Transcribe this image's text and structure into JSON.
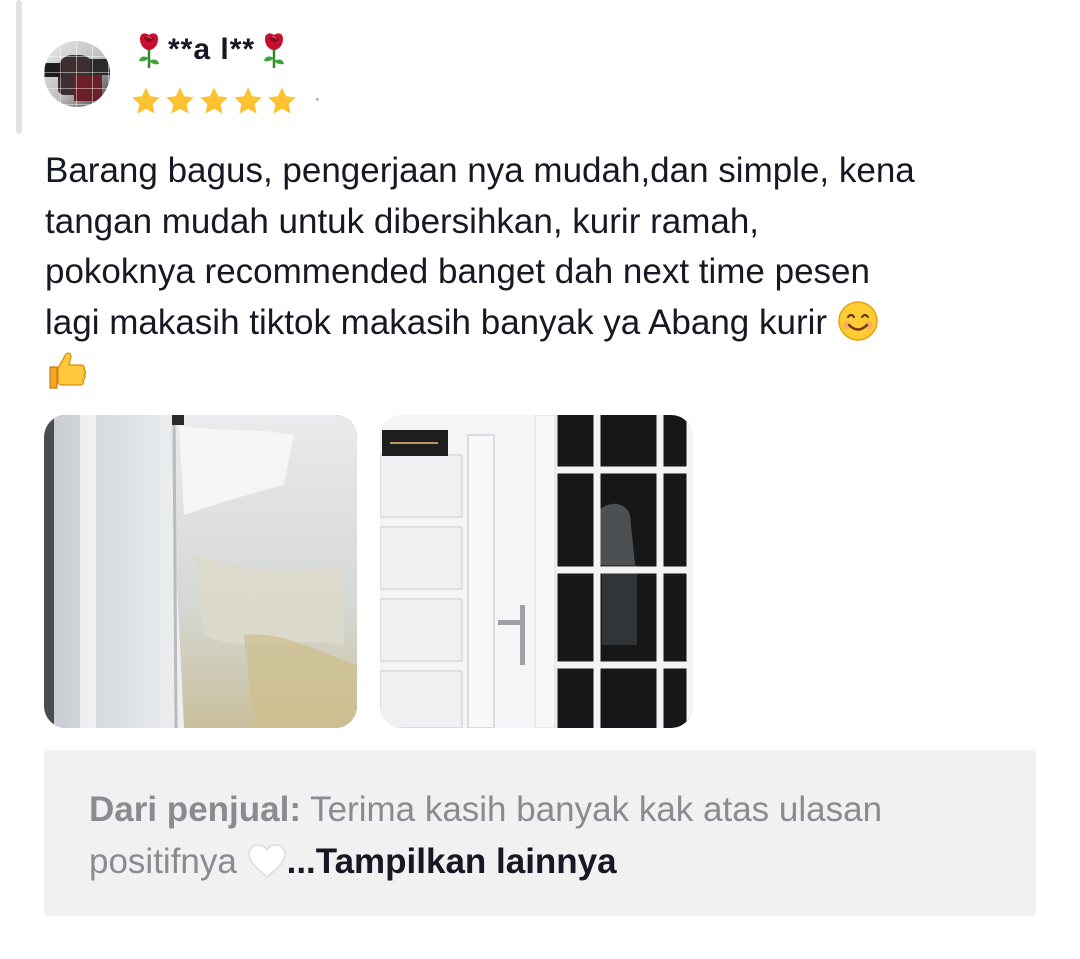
{
  "review": {
    "username": "**a l**",
    "rating": 5,
    "separator": "·",
    "text_lines": [
      "Barang bagus, pengerjaan nya mudah,dan simple, kena",
      "tangan mudah untuk dibersihkan, kurir ramah,",
      "pokoknya recommended banget dah next time pesen",
      "lagi makasih tiktok makasih banyak ya Abang kurir"
    ],
    "emojis": [
      "smiling-face-emoji",
      "thumbs-up-emoji"
    ]
  },
  "photos": [
    {
      "name": "review-photo-wall-corner"
    },
    {
      "name": "review-photo-white-door"
    }
  ],
  "seller_reply": {
    "label": "Dari penjual:",
    "text_line1": "Terima kasih banyak kak atas ulasan",
    "text_line2": "positifnya",
    "more_link": "...Tampilkan lainnya"
  },
  "colors": {
    "star": "#fcc232",
    "text_primary": "#161823",
    "text_secondary": "#8a8b91",
    "reply_background": "#f1f1f2",
    "rose_red": "#c8102e"
  }
}
